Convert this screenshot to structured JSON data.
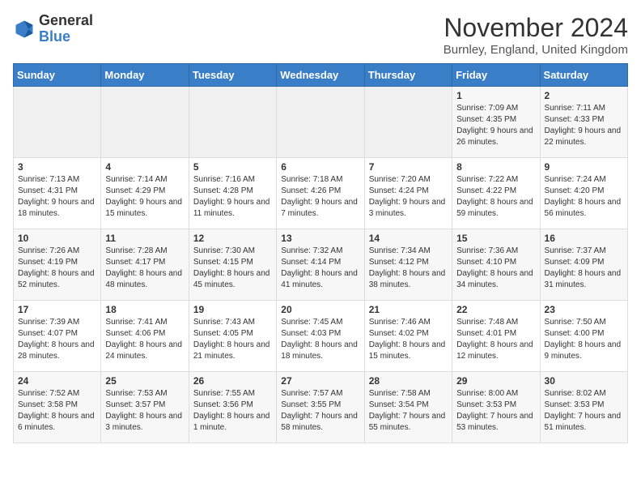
{
  "logo": {
    "text_general": "General",
    "text_blue": "Blue"
  },
  "header": {
    "month_title": "November 2024",
    "location": "Burnley, England, United Kingdom"
  },
  "days_of_week": [
    "Sunday",
    "Monday",
    "Tuesday",
    "Wednesday",
    "Thursday",
    "Friday",
    "Saturday"
  ],
  "weeks": [
    [
      {
        "day": "",
        "info": ""
      },
      {
        "day": "",
        "info": ""
      },
      {
        "day": "",
        "info": ""
      },
      {
        "day": "",
        "info": ""
      },
      {
        "day": "",
        "info": ""
      },
      {
        "day": "1",
        "info": "Sunrise: 7:09 AM\nSunset: 4:35 PM\nDaylight: 9 hours and 26 minutes."
      },
      {
        "day": "2",
        "info": "Sunrise: 7:11 AM\nSunset: 4:33 PM\nDaylight: 9 hours and 22 minutes."
      }
    ],
    [
      {
        "day": "3",
        "info": "Sunrise: 7:13 AM\nSunset: 4:31 PM\nDaylight: 9 hours and 18 minutes."
      },
      {
        "day": "4",
        "info": "Sunrise: 7:14 AM\nSunset: 4:29 PM\nDaylight: 9 hours and 15 minutes."
      },
      {
        "day": "5",
        "info": "Sunrise: 7:16 AM\nSunset: 4:28 PM\nDaylight: 9 hours and 11 minutes."
      },
      {
        "day": "6",
        "info": "Sunrise: 7:18 AM\nSunset: 4:26 PM\nDaylight: 9 hours and 7 minutes."
      },
      {
        "day": "7",
        "info": "Sunrise: 7:20 AM\nSunset: 4:24 PM\nDaylight: 9 hours and 3 minutes."
      },
      {
        "day": "8",
        "info": "Sunrise: 7:22 AM\nSunset: 4:22 PM\nDaylight: 8 hours and 59 minutes."
      },
      {
        "day": "9",
        "info": "Sunrise: 7:24 AM\nSunset: 4:20 PM\nDaylight: 8 hours and 56 minutes."
      }
    ],
    [
      {
        "day": "10",
        "info": "Sunrise: 7:26 AM\nSunset: 4:19 PM\nDaylight: 8 hours and 52 minutes."
      },
      {
        "day": "11",
        "info": "Sunrise: 7:28 AM\nSunset: 4:17 PM\nDaylight: 8 hours and 48 minutes."
      },
      {
        "day": "12",
        "info": "Sunrise: 7:30 AM\nSunset: 4:15 PM\nDaylight: 8 hours and 45 minutes."
      },
      {
        "day": "13",
        "info": "Sunrise: 7:32 AM\nSunset: 4:14 PM\nDaylight: 8 hours and 41 minutes."
      },
      {
        "day": "14",
        "info": "Sunrise: 7:34 AM\nSunset: 4:12 PM\nDaylight: 8 hours and 38 minutes."
      },
      {
        "day": "15",
        "info": "Sunrise: 7:36 AM\nSunset: 4:10 PM\nDaylight: 8 hours and 34 minutes."
      },
      {
        "day": "16",
        "info": "Sunrise: 7:37 AM\nSunset: 4:09 PM\nDaylight: 8 hours and 31 minutes."
      }
    ],
    [
      {
        "day": "17",
        "info": "Sunrise: 7:39 AM\nSunset: 4:07 PM\nDaylight: 8 hours and 28 minutes."
      },
      {
        "day": "18",
        "info": "Sunrise: 7:41 AM\nSunset: 4:06 PM\nDaylight: 8 hours and 24 minutes."
      },
      {
        "day": "19",
        "info": "Sunrise: 7:43 AM\nSunset: 4:05 PM\nDaylight: 8 hours and 21 minutes."
      },
      {
        "day": "20",
        "info": "Sunrise: 7:45 AM\nSunset: 4:03 PM\nDaylight: 8 hours and 18 minutes."
      },
      {
        "day": "21",
        "info": "Sunrise: 7:46 AM\nSunset: 4:02 PM\nDaylight: 8 hours and 15 minutes."
      },
      {
        "day": "22",
        "info": "Sunrise: 7:48 AM\nSunset: 4:01 PM\nDaylight: 8 hours and 12 minutes."
      },
      {
        "day": "23",
        "info": "Sunrise: 7:50 AM\nSunset: 4:00 PM\nDaylight: 8 hours and 9 minutes."
      }
    ],
    [
      {
        "day": "24",
        "info": "Sunrise: 7:52 AM\nSunset: 3:58 PM\nDaylight: 8 hours and 6 minutes."
      },
      {
        "day": "25",
        "info": "Sunrise: 7:53 AM\nSunset: 3:57 PM\nDaylight: 8 hours and 3 minutes."
      },
      {
        "day": "26",
        "info": "Sunrise: 7:55 AM\nSunset: 3:56 PM\nDaylight: 8 hours and 1 minute."
      },
      {
        "day": "27",
        "info": "Sunrise: 7:57 AM\nSunset: 3:55 PM\nDaylight: 7 hours and 58 minutes."
      },
      {
        "day": "28",
        "info": "Sunrise: 7:58 AM\nSunset: 3:54 PM\nDaylight: 7 hours and 55 minutes."
      },
      {
        "day": "29",
        "info": "Sunrise: 8:00 AM\nSunset: 3:53 PM\nDaylight: 7 hours and 53 minutes."
      },
      {
        "day": "30",
        "info": "Sunrise: 8:02 AM\nSunset: 3:53 PM\nDaylight: 7 hours and 51 minutes."
      }
    ]
  ]
}
